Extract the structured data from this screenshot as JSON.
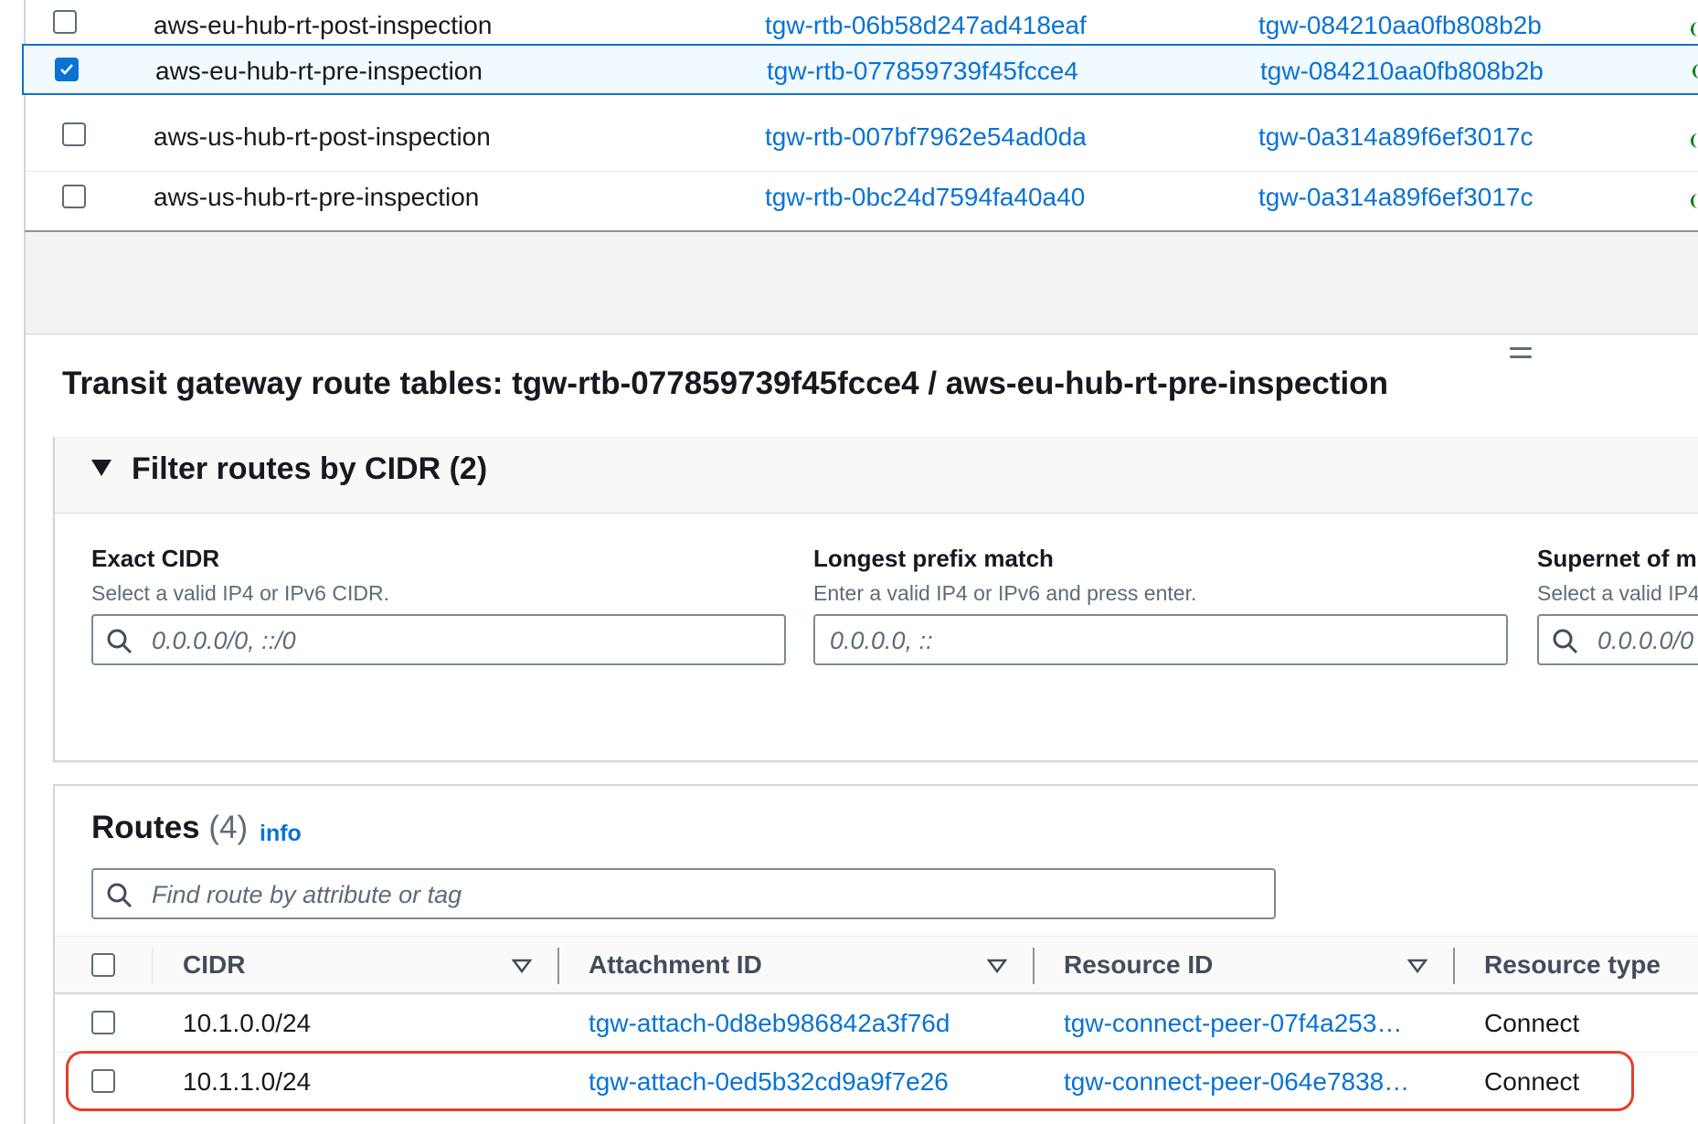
{
  "route_tables": [
    {
      "name": "aws-eu-hub-rt-post-inspection",
      "route_table_id": "tgw-rtb-06b58d247ad418eaf",
      "transit_gateway_id": "tgw-084210aa0fb808b2b",
      "selected": false
    },
    {
      "name": "aws-eu-hub-rt-pre-inspection",
      "route_table_id": "tgw-rtb-077859739f45fcce4",
      "transit_gateway_id": "tgw-084210aa0fb808b2b",
      "selected": true
    },
    {
      "name": "aws-us-hub-rt-post-inspection",
      "route_table_id": "tgw-rtb-007bf7962e54ad0da",
      "transit_gateway_id": "tgw-0a314a89f6ef3017c",
      "selected": false
    },
    {
      "name": "aws-us-hub-rt-pre-inspection",
      "route_table_id": "tgw-rtb-0bc24d7594fa40a40",
      "transit_gateway_id": "tgw-0a314a89f6ef3017c",
      "selected": false
    }
  ],
  "detail": {
    "title": "Transit gateway route tables: tgw-rtb-077859739f45fcce4 / aws-eu-hub-rt-pre-inspection"
  },
  "filter": {
    "title": "Filter routes by CIDR (2)",
    "fields": [
      {
        "label": "Exact CIDR",
        "description": "Select a valid IP4 or IPv6 CIDR.",
        "placeholder": "0.0.0.0/0, ::/0",
        "has_search_icon": true
      },
      {
        "label": "Longest prefix match",
        "description": "Enter a valid IP4 or IPv6 and press enter.",
        "placeholder": "0.0.0.0, ::",
        "has_search_icon": false
      },
      {
        "label": "Supernet of m",
        "description": "Select a valid IP4",
        "placeholder": "0.0.0.0/0",
        "has_search_icon": true
      }
    ]
  },
  "routes": {
    "title": "Routes",
    "count": "(4)",
    "info_label": "info",
    "search_placeholder": "Find route by attribute or tag",
    "columns": [
      "CIDR",
      "Attachment ID",
      "Resource ID",
      "Resource type"
    ],
    "rows": [
      {
        "cidr": "10.1.0.0/24",
        "attachment_id": "tgw-attach-0d8eb986842a3f76d",
        "resource_id": "tgw-connect-peer-07f4a253…",
        "resource_type": "Connect",
        "highlighted": false
      },
      {
        "cidr": "10.1.1.0/24",
        "attachment_id": "tgw-attach-0ed5b32cd9a9f7e26",
        "resource_id": "tgw-connect-peer-064e7838…",
        "resource_type": "Connect",
        "highlighted": true
      }
    ]
  },
  "colors": {
    "link": "#0972d3",
    "selected_row_bg": "#f1faff",
    "highlight_annotation": "#e53d2b",
    "status_green": "#037f0c"
  },
  "icons": [
    "checkbox",
    "checkbox-checked-icon",
    "search-icon",
    "caret-down-icon",
    "sort-caret-icon",
    "drag-handle-icon"
  ]
}
